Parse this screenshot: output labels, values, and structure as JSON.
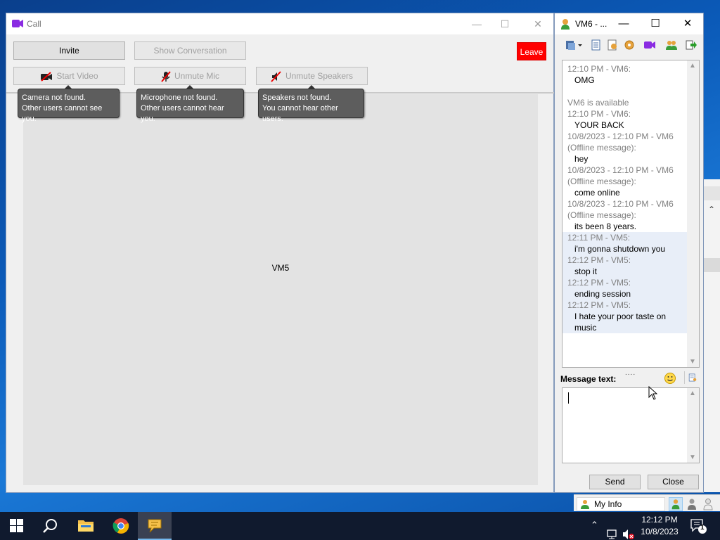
{
  "call_window": {
    "title": "Call",
    "controls": {
      "minimize": "—",
      "maximize": "☐",
      "close": "✕"
    },
    "buttons": {
      "invite": "Invite",
      "show_conversation": "Show Conversation",
      "leave": "Leave",
      "start_video": "Start Video",
      "unmute_mic": "Unmute Mic",
      "unmute_speakers": "Unmute Speakers"
    },
    "tooltips": {
      "camera": [
        "Camera not found.",
        "Other users cannot see you."
      ],
      "microphone": [
        "Microphone not found.",
        "Other users cannot hear you."
      ],
      "speakers": [
        "Speakers not found.",
        "You cannot hear other users."
      ]
    },
    "participant": "VM5",
    "colors": {
      "leave_bg": "#ff0000",
      "video_icon": "#8a2be2"
    }
  },
  "chat_window": {
    "title": "VM6 - ...",
    "controls": {
      "minimize": "—",
      "maximize": "☐",
      "close": "✕"
    },
    "toolbar_icons": [
      "send-file-icon",
      "history-icon",
      "contact-info-icon",
      "nudge-icon",
      "video-call-icon",
      "invite-users-icon",
      "exit-icon"
    ],
    "messages": [
      {
        "text": "12:10 PM - VM6:",
        "style": "gray"
      },
      {
        "text": "OMG",
        "style": "body"
      },
      {
        "text": "",
        "style": "gap"
      },
      {
        "text": "VM6 is available",
        "style": "gray"
      },
      {
        "text": "12:10 PM - VM6:",
        "style": "gray"
      },
      {
        "text": "YOUR BACK",
        "style": "body"
      },
      {
        "text": "10/8/2023 - 12:10 PM - VM6",
        "style": "gray"
      },
      {
        "text": "(Offline message):",
        "style": "gray"
      },
      {
        "text": "hey",
        "style": "body"
      },
      {
        "text": "10/8/2023 - 12:10 PM - VM6",
        "style": "gray"
      },
      {
        "text": "(Offline message):",
        "style": "gray"
      },
      {
        "text": "come online",
        "style": "body"
      },
      {
        "text": "10/8/2023 - 12:10 PM - VM6",
        "style": "gray"
      },
      {
        "text": "(Offline message):",
        "style": "gray"
      },
      {
        "text": "its been 8 years.",
        "style": "body"
      },
      {
        "text": "12:11 PM - VM5:",
        "style": "gray hl"
      },
      {
        "text": "i'm gonna shutdown you",
        "style": "body hl"
      },
      {
        "text": "12:12 PM - VM5:",
        "style": "gray hl"
      },
      {
        "text": "stop it",
        "style": "body hl"
      },
      {
        "text": "12:12 PM - VM5:",
        "style": "gray hl"
      },
      {
        "text": "ending session",
        "style": "body hl"
      },
      {
        "text": "12:12 PM - VM5:",
        "style": "gray hl"
      },
      {
        "text": "I hate your poor taste on",
        "style": "body hl"
      },
      {
        "text": "music",
        "style": "body hl"
      }
    ],
    "splitter": "....",
    "message_label": "Message text:",
    "input_value": "",
    "send_label": "Send",
    "close_label": "Close"
  },
  "contact_strip": {
    "my_info": "My Info"
  },
  "taskbar": {
    "time": "12:12 PM",
    "date": "10/8/2023",
    "notification_count": "1",
    "apps": [
      "start-button",
      "search-button",
      "file-explorer",
      "chrome",
      "chat-app"
    ]
  }
}
